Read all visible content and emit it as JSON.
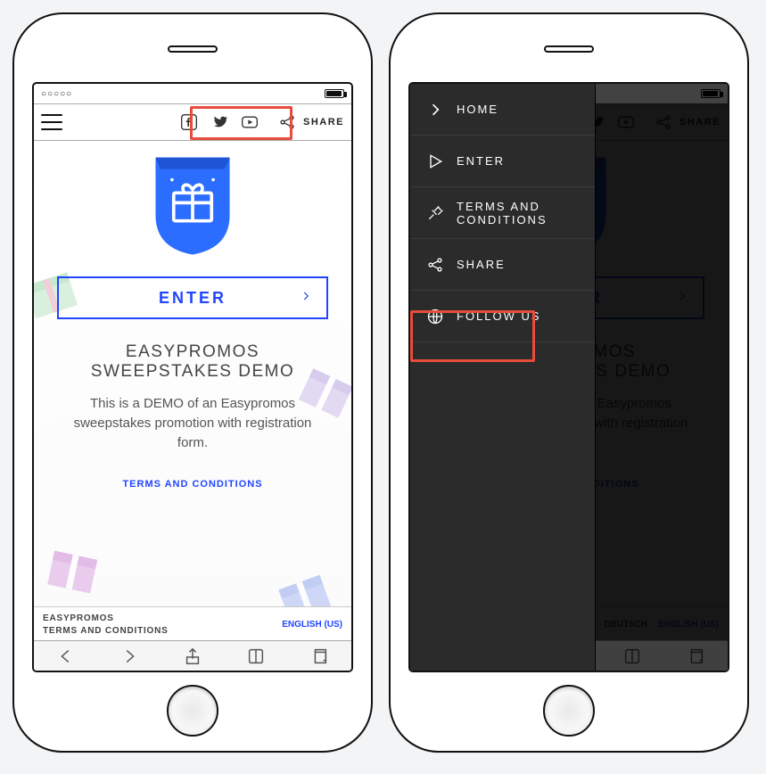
{
  "topbar": {
    "share_label": "SHARE"
  },
  "main": {
    "enter_label": "ENTER",
    "title": "EASYPROMOS SWEEPSTAKES DEMO",
    "description": "This is a DEMO of an Easypromos sweepstakes promotion with registration form.",
    "terms_link": "TERMS AND CONDITIONS"
  },
  "footer": {
    "brand": "EASYPROMOS",
    "terms": "TERMS AND CONDITIONS",
    "deutsch": "DEUTSCH",
    "english": "ENGLISH (US)"
  },
  "menu": {
    "items": [
      {
        "label": "HOME"
      },
      {
        "label": "ENTER"
      },
      {
        "label": "TERMS AND CONDITIONS"
      },
      {
        "label": "SHARE"
      },
      {
        "label": "FOLLOW US"
      }
    ]
  },
  "status": {
    "dots": "○○○○○"
  }
}
